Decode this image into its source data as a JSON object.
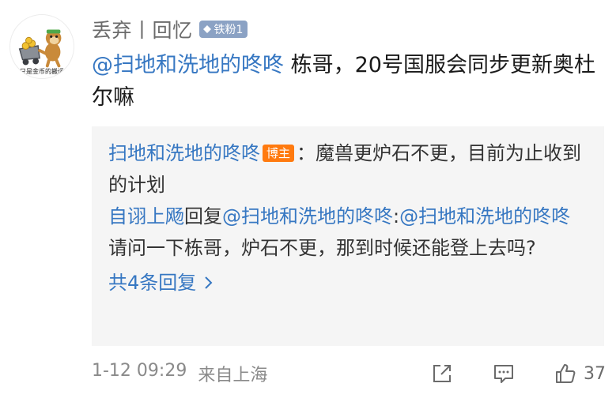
{
  "comment": {
    "avatar_icon": "monkey-cart-icon",
    "avatar_caption": "只是金币的搬运",
    "username": "丢弃丨回忆",
    "fan_badge": "铁粉1",
    "mention": "@扫地和洗地的咚咚",
    "text": " 栋哥，20号国服会同步更新奥杜尔嘛"
  },
  "replies": {
    "first": {
      "author": "扫地和洗地的咚咚",
      "author_tag": "博主",
      "text": "：魔兽更炉石不更，目前为止收到的计划"
    },
    "second": {
      "author": "自诩上飏",
      "reply_word": "回复",
      "mention1": "@扫地和洗地的咚咚",
      "separator": ":",
      "mention2": "@扫地和洗地的咚咚",
      "text": " 请问一下栋哥，炉石不更，那到时候还能登上去吗?"
    },
    "more_label": "共4条回复"
  },
  "footer": {
    "date": "1-12 09:29",
    "location": "来自上海",
    "like_count": "37"
  },
  "colors": {
    "link": "#3677c2",
    "author_tag_bg": "#ff7a0f",
    "badge_bg": "#8ba2c4",
    "reply_bg": "#f5f5f5"
  }
}
